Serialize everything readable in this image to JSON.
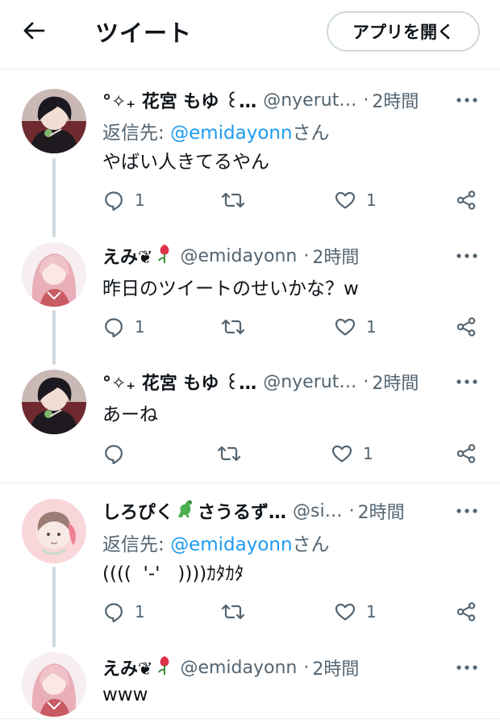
{
  "header": {
    "title": "ツイート",
    "open_app_label": "アプリを開く",
    "back_icon": "arrow-left-icon"
  },
  "colors": {
    "accent": "#1d9bf0",
    "secondary_text": "#536471",
    "thread_line": "#cfd9de"
  },
  "tweets": [
    {
      "name": "°✧₊ 花宮 もゆ ꒰…",
      "handle": "@nyerut…",
      "dot": "·",
      "time": "2時間",
      "reply_prefix": "返信先: ",
      "reply_mention": "@emidayonn",
      "reply_suffix": "さん",
      "text": "やばい人きてるやん",
      "reply_count": "1",
      "retweet_count": "",
      "like_count": "1"
    },
    {
      "name": "えみ❦",
      "name_emoji": "rose-emoji",
      "handle": "@emidayonn",
      "dot": "·",
      "time": "2時間",
      "text": "昨日のツイートのせいかな？w",
      "reply_count": "1",
      "retweet_count": "",
      "like_count": "1"
    },
    {
      "name": "°✧₊ 花宮 もゆ ꒰…",
      "handle": "@nyerut…",
      "dot": "·",
      "time": "2時間",
      "text": "あーね",
      "reply_count": "",
      "retweet_count": "",
      "like_count": "1"
    },
    {
      "name": "しろぴく",
      "name_emoji": "dinosaur-emoji",
      "name_after": "さうるず…",
      "handle": "@si…",
      "dot": "·",
      "time": "2時間",
      "reply_prefix": "返信先: ",
      "reply_mention": "@emidayonn",
      "reply_suffix": "さん",
      "text": "((((  '-'   ))))ｶﾀｶﾀ",
      "reply_count": "1",
      "retweet_count": "",
      "like_count": "1"
    },
    {
      "name": "えみ❦",
      "name_emoji": "rose-emoji",
      "handle": "@emidayonn",
      "dot": "·",
      "time": "2時間",
      "text": "www"
    }
  ]
}
